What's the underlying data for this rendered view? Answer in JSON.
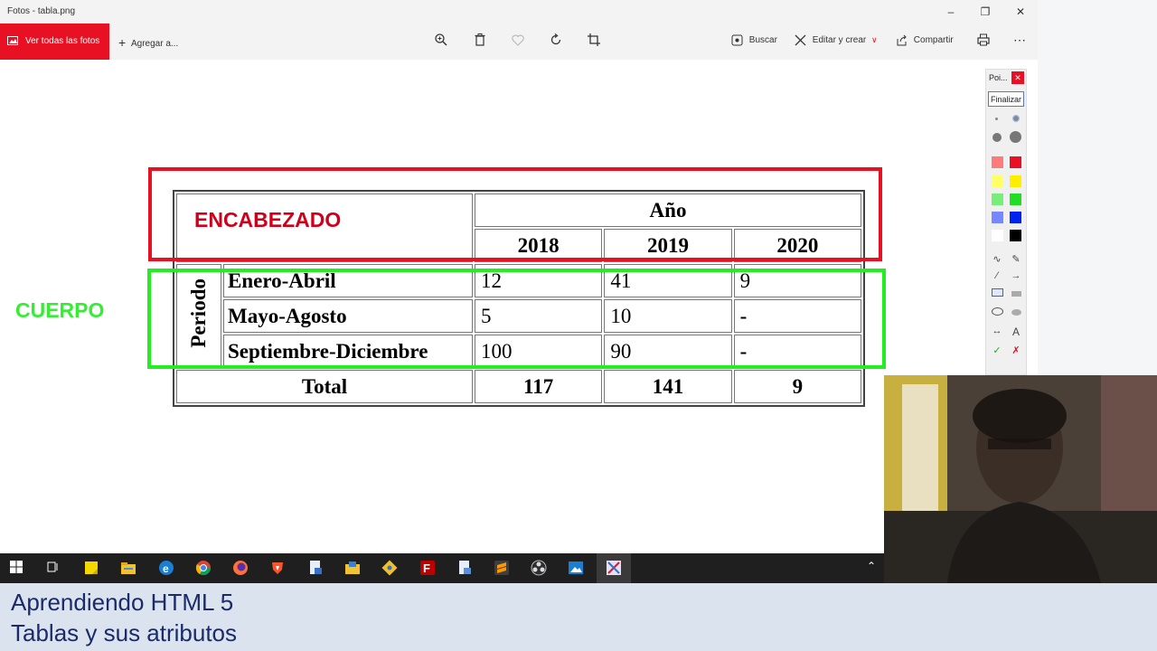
{
  "window": {
    "title": "Fotos - tabla.png"
  },
  "toolbar": {
    "view_all": "Ver todas las fotos",
    "add_to": "Agregar a...",
    "search": "Buscar",
    "edit_create": "Editar y crear",
    "share": "Compartir"
  },
  "annotations": {
    "header_label": "ENCABEZADO",
    "body_label": "CUERPO"
  },
  "table": {
    "year_header": "Año",
    "years": [
      "2018",
      "2019",
      "2020"
    ],
    "period_label": "Periodo",
    "rows": [
      {
        "label": "Enero-Abril",
        "values": [
          "12",
          "41",
          "9"
        ]
      },
      {
        "label": "Mayo-Agosto",
        "values": [
          "5",
          "10",
          "-"
        ]
      },
      {
        "label": "Septiembre-Diciembre",
        "values": [
          "100",
          "90",
          "-"
        ]
      }
    ],
    "total_label": "Total",
    "totals": [
      "117",
      "141",
      "9"
    ]
  },
  "palette": {
    "title": "Poi...",
    "finish_button": "Finalizar",
    "text_tool": "A",
    "colors": [
      "#ff7a7a",
      "#e81123",
      "#ffff66",
      "#ffee00",
      "#77ee77",
      "#22dd22",
      "#7788ff",
      "#0022ee",
      "#ffffff",
      "#000000"
    ]
  },
  "caption": {
    "line1": "Aprendiendo HTML 5",
    "line2": "Tablas y sus atributos"
  }
}
